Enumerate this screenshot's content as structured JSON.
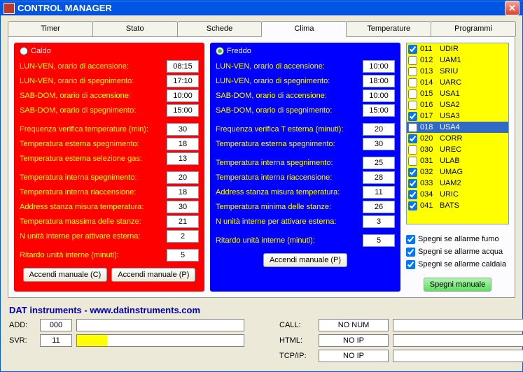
{
  "window": {
    "title": "CONTROL MANAGER"
  },
  "tabs": [
    "Timer",
    "Stato",
    "Schede",
    "Clima",
    "Temperature",
    "Programmi"
  ],
  "active_tab": 3,
  "caldo": {
    "title": "Caldo",
    "rows1": [
      {
        "label": "LUN-VEN, orario di accensione:",
        "value": "08:15"
      },
      {
        "label": "LUN-VEN, orario di spegnimento:",
        "value": "17:10"
      },
      {
        "label": "SAB-DOM, orario di accensione:",
        "value": "10:00"
      },
      {
        "label": "SAB-DOM, orario di spegnimento:",
        "value": "15:00"
      }
    ],
    "rows2": [
      {
        "label": "Frequenza verifica temperature (min):",
        "value": "30"
      },
      {
        "label": "Temperatura esterna spegnimento:",
        "value": "18"
      },
      {
        "label": "Temperatura esterna selezione gas:",
        "value": "13"
      }
    ],
    "rows3": [
      {
        "label": "Temperatura interna spegnimento:",
        "value": "20"
      },
      {
        "label": "Temperatura interna riaccensione:",
        "value": "18"
      },
      {
        "label": "Address stanza misura temperatura:",
        "value": "30"
      },
      {
        "label": "Temperatura massima delle stanze:",
        "value": "21"
      },
      {
        "label": "N unità interne per attivare esterna:",
        "value": "2"
      }
    ],
    "rows4": [
      {
        "label": "Ritardo unità interne (minuti):",
        "value": "5"
      }
    ],
    "btn_c": "Accendi manuale (C)",
    "btn_p": "Accendi manuale (P)"
  },
  "freddo": {
    "title": "Freddo",
    "rows1": [
      {
        "label": "LUN-VEN, orario di accensione:",
        "value": "10:00"
      },
      {
        "label": "LUN-VEN, orario di spegnimento:",
        "value": "18:00"
      },
      {
        "label": "SAB-DOM, orario di accensione:",
        "value": "10:00"
      },
      {
        "label": "SAB-DOM, orario di spegnimento:",
        "value": "15:00"
      }
    ],
    "rows2": [
      {
        "label": "Frequenza verifica T esterna (minuti):",
        "value": "20"
      },
      {
        "label": "Temperatura esterna spegnimento:",
        "value": "30"
      }
    ],
    "rows3": [
      {
        "label": "Temperatura interna spegnimento:",
        "value": "25"
      },
      {
        "label": "Temperatura interna riaccensione:",
        "value": "28"
      },
      {
        "label": "Address stanza misura temperatura:",
        "value": "11"
      },
      {
        "label": "Temperatura minima delle stanze:",
        "value": "26"
      },
      {
        "label": "N unità interne per attivare esterna:",
        "value": "3"
      }
    ],
    "rows4": [
      {
        "label": "Ritardo unità interne (minuti):",
        "value": "5"
      }
    ],
    "btn_p": "Accendi manuale (P)"
  },
  "list": [
    {
      "checked": true,
      "code": "011",
      "name": "UDIR",
      "selected": false
    },
    {
      "checked": false,
      "code": "012",
      "name": "UAM1",
      "selected": false
    },
    {
      "checked": false,
      "code": "013",
      "name": "SRIU",
      "selected": false
    },
    {
      "checked": false,
      "code": "014",
      "name": "UARC",
      "selected": false
    },
    {
      "checked": false,
      "code": "015",
      "name": "USA1",
      "selected": false
    },
    {
      "checked": false,
      "code": "016",
      "name": "USA2",
      "selected": false
    },
    {
      "checked": true,
      "code": "017",
      "name": "USA3",
      "selected": false
    },
    {
      "checked": false,
      "code": "018",
      "name": "USA4",
      "selected": true
    },
    {
      "checked": true,
      "code": "020",
      "name": "CORR",
      "selected": false
    },
    {
      "checked": false,
      "code": "030",
      "name": "UREC",
      "selected": false
    },
    {
      "checked": false,
      "code": "031",
      "name": "ULAB",
      "selected": false
    },
    {
      "checked": true,
      "code": "032",
      "name": "UMAG",
      "selected": false
    },
    {
      "checked": true,
      "code": "033",
      "name": "UAM2",
      "selected": false
    },
    {
      "checked": true,
      "code": "034",
      "name": "URIC",
      "selected": false
    },
    {
      "checked": true,
      "code": "041",
      "name": "BATS",
      "selected": false
    }
  ],
  "opts": [
    {
      "checked": true,
      "label": "Spegni se allarme fumo"
    },
    {
      "checked": true,
      "label": "Spegni se allarme acqua"
    },
    {
      "checked": true,
      "label": "Spegni se allarme caldaia"
    }
  ],
  "btn_spegni": "Spegni manuale",
  "footer": {
    "brand": "DAT instruments - www.datinstruments.com",
    "add_lbl": "ADD:",
    "add_val": "000",
    "svr_lbl": "SVR:",
    "svr_val": "11",
    "svr_fill_pct": 18,
    "call_lbl": "CALL:",
    "call_val": "NO NUM",
    "html_lbl": "HTML:",
    "html_val": "NO IP",
    "tcp_lbl": "TCP/IP:",
    "tcp_val": "NO IP"
  }
}
